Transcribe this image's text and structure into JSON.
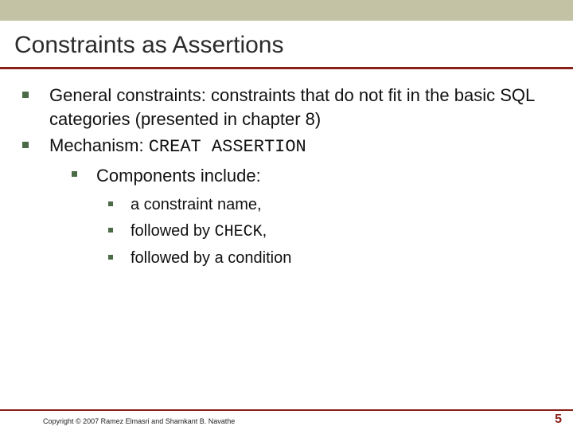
{
  "title": "Constraints as Assertions",
  "bullets": {
    "lvl1": [
      {
        "text": "General constraints: constraints that do not fit in the basic SQL categories (presented in chapter 8)"
      },
      {
        "prefix": "Mechanism: ",
        "code": "CREAT ASSERTION"
      }
    ],
    "lvl2": [
      {
        "text": "Components include:"
      }
    ],
    "lvl3": [
      {
        "text": "a constraint name,"
      },
      {
        "prefix": "followed by ",
        "code": "CHECK",
        "suffix": ","
      },
      {
        "text": "followed by a condition"
      }
    ]
  },
  "footer": {
    "copyright": "Copyright © 2007 Ramez Elmasri and Shamkant B. Navathe",
    "page": "5"
  }
}
